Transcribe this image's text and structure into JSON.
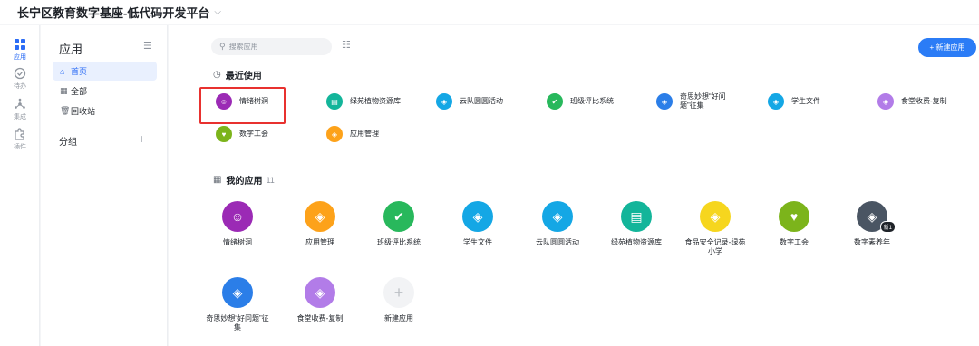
{
  "topbar": {
    "title": "长宁区教育数字基座-低代码开发平台",
    "chevron": "chevron-down-icon"
  },
  "rail": [
    {
      "label": "应用",
      "icon": "apps-grid-icon",
      "active": true
    },
    {
      "label": "待办",
      "icon": "check-circle-icon",
      "active": false
    },
    {
      "label": "集成",
      "icon": "integration-icon",
      "active": false
    },
    {
      "label": "插件",
      "icon": "plugin-icon",
      "active": false
    }
  ],
  "sidebar": {
    "title": "应用",
    "items": [
      {
        "label": "首页",
        "icon": "home-icon",
        "active": true
      },
      {
        "label": "全部",
        "icon": "grid-icon",
        "active": false
      },
      {
        "label": "回收站",
        "icon": "trash-icon",
        "active": false
      }
    ],
    "group_label": "分组"
  },
  "toolbar": {
    "search_placeholder": "搜索应用",
    "new_app_label": "+ 新建应用"
  },
  "recent": {
    "heading": "最近使用",
    "items": [
      {
        "label": "情绪树洞",
        "color": "#9b2ab5"
      },
      {
        "label": "绿苑植物资源库",
        "color": "#13b59a"
      },
      {
        "label": "云队圆圆活动",
        "color": "#14a7e5"
      },
      {
        "label": "班级评比系统",
        "color": "#28b85c"
      },
      {
        "label": "奇思妙想“好问题”征集",
        "color": "#2b7ee8"
      },
      {
        "label": "学生文件",
        "color": "#14a7e5"
      },
      {
        "label": "食堂收费-复制",
        "color": "#b27ce8"
      },
      {
        "label": "数字工会",
        "color": "#7cb41b"
      },
      {
        "label": "应用管理",
        "color": "#fda21a"
      }
    ]
  },
  "my_apps": {
    "heading": "我的应用",
    "count": "11",
    "items": [
      {
        "label": "情绪树洞",
        "color": "#9b2ab5"
      },
      {
        "label": "应用管理",
        "color": "#fda21a"
      },
      {
        "label": "班级评比系统",
        "color": "#28b85c"
      },
      {
        "label": "学生文件",
        "color": "#14a7e5"
      },
      {
        "label": "云队圆圆活动",
        "color": "#14a7e5"
      },
      {
        "label": "绿苑植物资源库",
        "color": "#13b59a"
      },
      {
        "label": "食品安全记录-绿苑小学",
        "color": "#f6d61e"
      },
      {
        "label": "数字工会",
        "color": "#7cb41b"
      },
      {
        "label": "数字素养年",
        "color": "#4a5563",
        "badge": "新1"
      },
      {
        "label": "奇思妙想“好问题”征集",
        "color": "#2b7ee8"
      },
      {
        "label": "食堂收费-复制",
        "color": "#b27ce8"
      },
      {
        "label": "新建应用",
        "color": "#f2f3f5"
      }
    ]
  }
}
